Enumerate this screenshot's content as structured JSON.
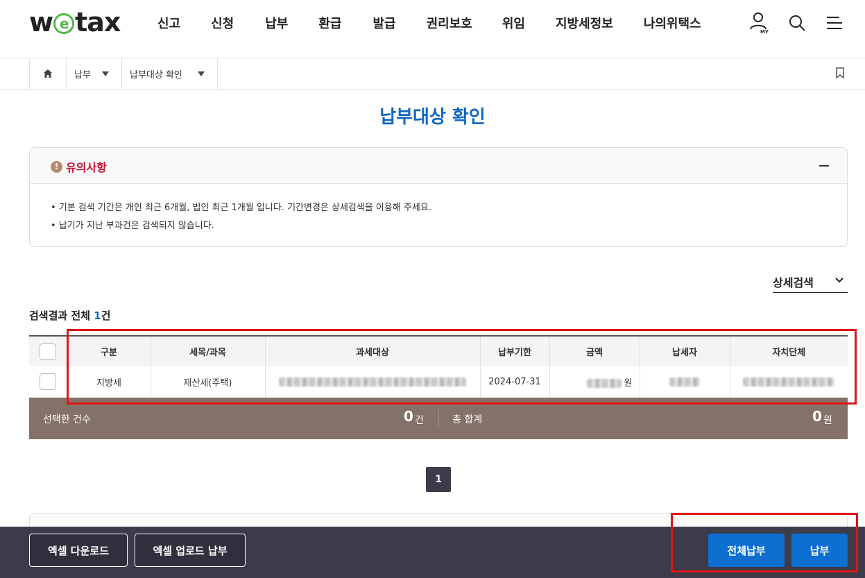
{
  "header": {
    "logo_pre": "w",
    "logo_e": "e",
    "logo_post": "tax",
    "logo_icon": "e-circle-logo",
    "nav": [
      "신고",
      "신청",
      "납부",
      "환급",
      "발급",
      "권리보호",
      "위임",
      "지방세정보",
      "나의위택스"
    ],
    "my_label": "MY",
    "icons": [
      "user-icon",
      "search-icon",
      "menu-icon"
    ]
  },
  "breadcrumb": {
    "home_icon": "home-icon",
    "level1": "납부",
    "level2": "납부대상 확인",
    "bookmark_icon": "bookmark-icon"
  },
  "page": {
    "title": "납부대상 확인"
  },
  "notice": {
    "icon": "!",
    "title": "유의사항",
    "items": [
      "기본 검색 기간은 개인 최근 6개월, 법인 최근 1개월 입니다. 기간변경은 상세검색을 이용해 주세요.",
      "납기가 지난 부과건은 검색되지 않습니다."
    ]
  },
  "detail_search": {
    "label": "상세검색",
    "icon": "chevron-down-icon"
  },
  "results": {
    "prefix": "검색결과 전체 ",
    "count": "1",
    "suffix": "건"
  },
  "table": {
    "headers": [
      "구분",
      "세목/과목",
      "과세대상",
      "납부기한",
      "금액",
      "납세자",
      "자치단체"
    ],
    "rows": [
      {
        "category": "지방세",
        "tax_item": "재산세(주택)",
        "due_date": "2024-07-31",
        "amount_unit": "원"
      }
    ]
  },
  "summary": {
    "selected_label": "선택한 건수",
    "selected_count": "0",
    "selected_unit": "건",
    "total_label": "총 합계",
    "total_amount": "0",
    "total_unit": "원"
  },
  "pagination": {
    "current": "1"
  },
  "footer": {
    "excel_download": "엑셀 다운로드",
    "excel_upload_pay": "엑셀 업로드 납부",
    "pay_all": "전체납부",
    "pay": "납부"
  },
  "colors": {
    "brand_blue": "#1267c1",
    "button_blue": "#0d6fd1",
    "summary_brown": "#847167",
    "footer_dark": "#3b3b4a",
    "notice_red": "#c8102e",
    "logo_green": "#53b848",
    "highlight_red": "#e01414"
  }
}
